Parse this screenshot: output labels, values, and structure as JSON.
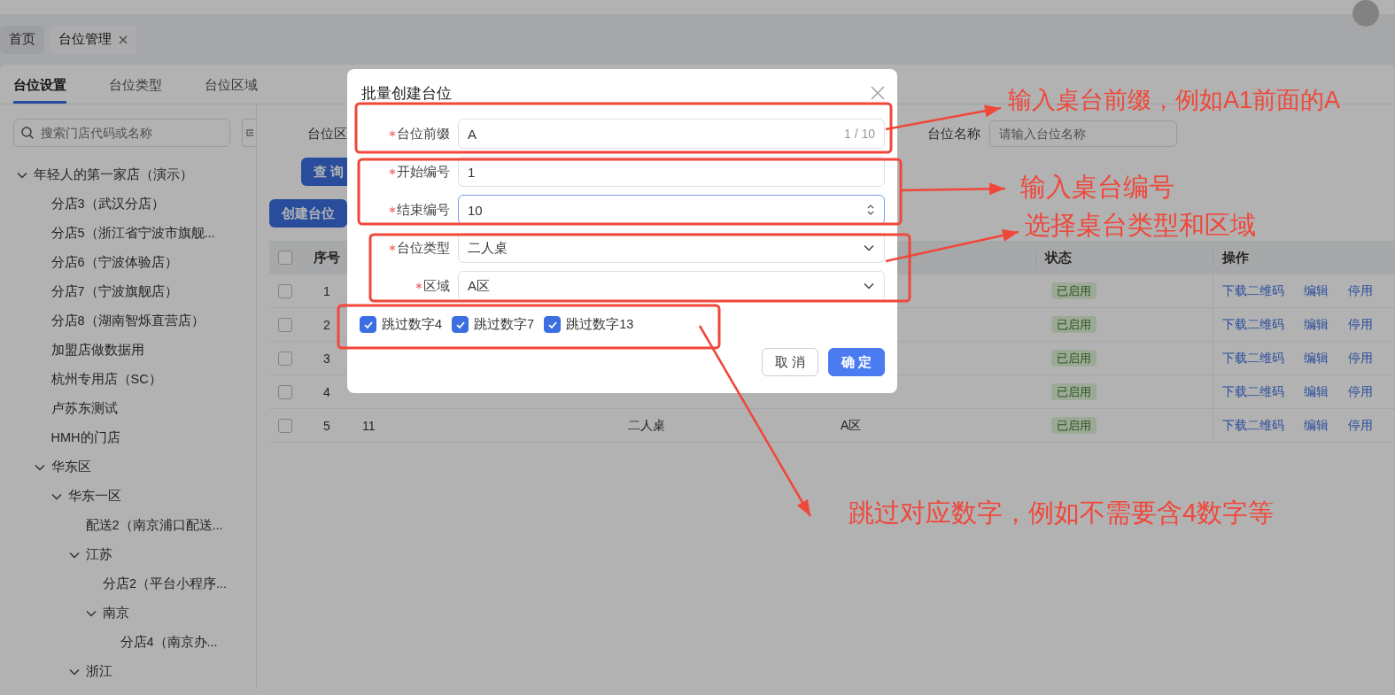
{
  "header_tabs": [
    {
      "label": "首页",
      "selected": false,
      "closable": false
    },
    {
      "label": "台位管理",
      "selected": true,
      "closable": true
    }
  ],
  "page_tabs": [
    {
      "label": "台位设置",
      "selected": true
    },
    {
      "label": "台位类型",
      "selected": false
    },
    {
      "label": "台位区域",
      "selected": false
    }
  ],
  "sidebar": {
    "search": {
      "placeholder": "搜索门店代码或名称"
    },
    "tree": [
      {
        "label": "年轻人的第一家店（演示）",
        "expanded": true,
        "children": [
          {
            "label": "分店3（武汉分店）"
          },
          {
            "label": "分店5（浙江省宁波市旗舰..."
          },
          {
            "label": "分店6（宁波体验店）"
          },
          {
            "label": "分店7（宁波旗舰店）"
          },
          {
            "label": "分店8（湖南智烁直营店）"
          },
          {
            "label": "加盟店做数据用"
          },
          {
            "label": "杭州专用店（SC）"
          },
          {
            "label": "卢苏东测试"
          },
          {
            "label": "HMH的门店"
          },
          {
            "label": "华东区",
            "expanded": true,
            "children": [
              {
                "label": "华东一区",
                "expanded": true,
                "children": [
                  {
                    "label": "配送2（南京浦口配送..."
                  },
                  {
                    "label": "江苏",
                    "expanded": true,
                    "children": [
                      {
                        "label": "分店2（平台小程序..."
                      },
                      {
                        "label": "南京",
                        "expanded": true,
                        "children": [
                          {
                            "label": "分店4（南京办..."
                          }
                        ]
                      }
                    ]
                  },
                  {
                    "label": "浙江",
                    "expanded": true
                  }
                ]
              }
            ]
          }
        ]
      }
    ]
  },
  "filters": {
    "area_label": "台位区",
    "query_button": "查 询",
    "name_label": "台位名称",
    "name_placeholder": "请输入台位名称"
  },
  "create_button": "创建台位",
  "table": {
    "select_all": {
      "checked": false
    },
    "columns": [
      "序号",
      "状态",
      "操作"
    ],
    "rows": [
      {
        "selected": false,
        "index": "1",
        "status": "已启用",
        "actions": [
          "下载二维码",
          "编辑",
          "停用"
        ]
      },
      {
        "selected": false,
        "index": "2",
        "status": "已启用",
        "actions": [
          "下载二维码",
          "编辑",
          "停用"
        ]
      },
      {
        "selected": false,
        "index": "3",
        "status": "已启用",
        "actions": [
          "下载二维码",
          "编辑",
          "停用"
        ]
      },
      {
        "selected": false,
        "index": "4",
        "status": "已启用",
        "actions": [
          "下载二维码",
          "编辑",
          "停用"
        ]
      },
      {
        "selected": false,
        "index": "5",
        "name": "11",
        "type": "二人桌",
        "area": "A区",
        "status": "已启用",
        "actions": [
          "下载二维码",
          "编辑",
          "停用"
        ]
      }
    ]
  },
  "dialog": {
    "title": "批量创建台位",
    "fields": [
      {
        "kind": "text",
        "label": "台位前缀",
        "required": true,
        "value": "A",
        "count": "1 / 10",
        "focused": false
      },
      {
        "kind": "number",
        "label": "开始编号",
        "required": true,
        "value": "1",
        "focused": false
      },
      {
        "kind": "number",
        "label": "结束编号",
        "required": true,
        "value": "10",
        "focused": true
      },
      {
        "kind": "select",
        "label": "台位类型",
        "required": true,
        "value": "二人桌",
        "focused": false
      },
      {
        "kind": "select",
        "label": "区域",
        "required": true,
        "value": "A区",
        "focused": false
      }
    ],
    "checkboxes": [
      {
        "label": "跳过数字4",
        "checked": true
      },
      {
        "label": "跳过数字7",
        "checked": true
      },
      {
        "label": "跳过数字13",
        "checked": true
      }
    ],
    "buttons": [
      {
        "label": "取 消",
        "kind": "default"
      },
      {
        "label": "确 定",
        "kind": "primary"
      }
    ]
  },
  "annotations": [
    {
      "text": "输入桌台前缀，例如A1前面的A"
    },
    {
      "text": "输入桌台编号"
    },
    {
      "text": "选择桌台类型和区域"
    },
    {
      "text": "跳过对应数字，例如不需要含4数字等"
    }
  ]
}
